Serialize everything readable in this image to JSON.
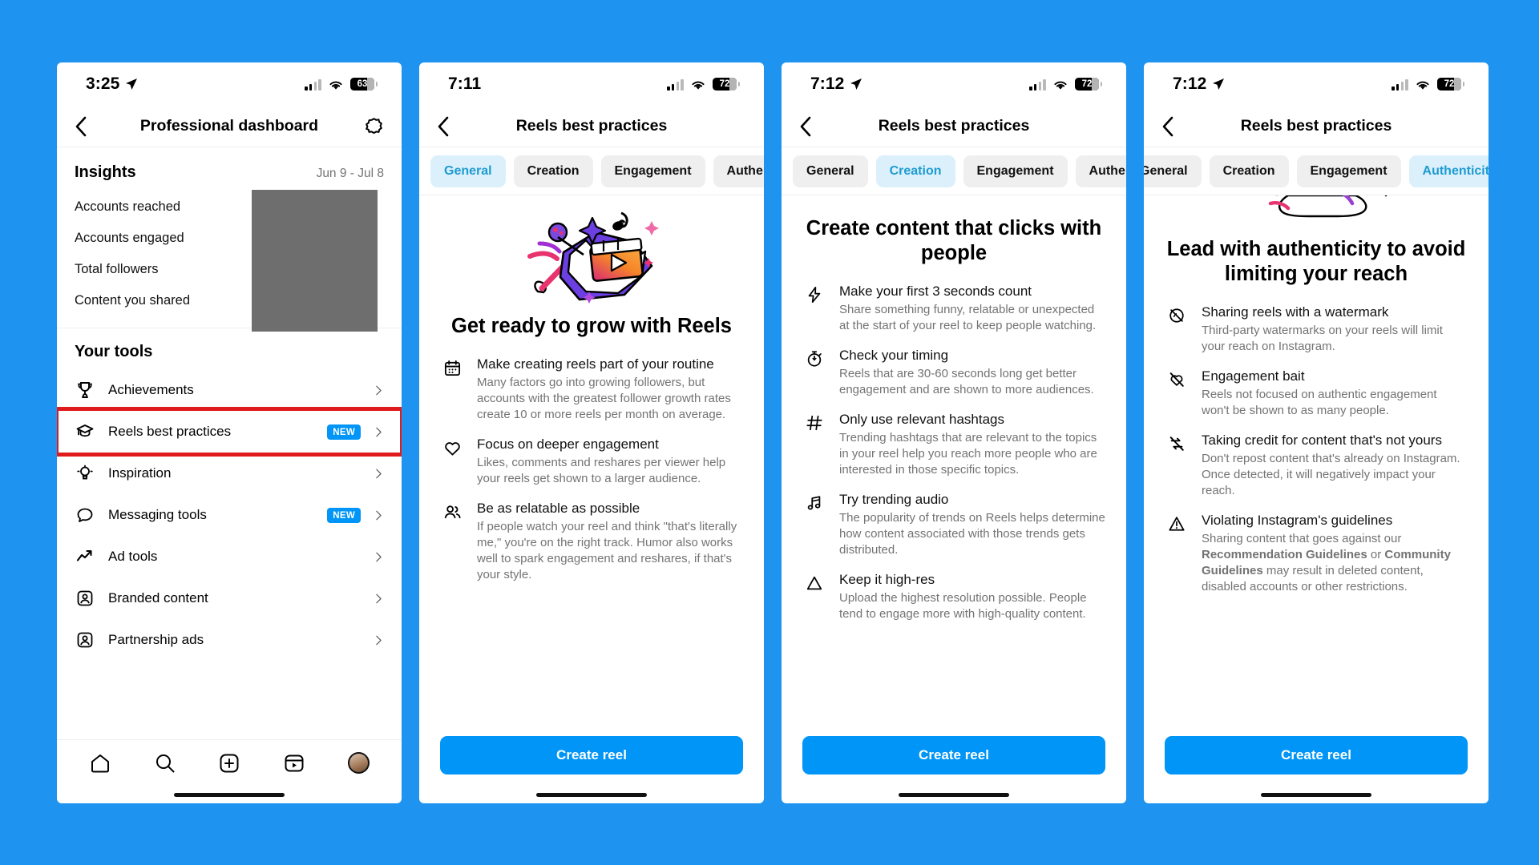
{
  "theme": {
    "background": "#1e94f0",
    "accent": "#0095f6",
    "pill_active_bg": "#dcf0fb",
    "pill_active_text": "#1d9bd1",
    "highlight": "#e01b1b",
    "muted_text": "#737373"
  },
  "panels": [
    {
      "id": "professional-dashboard",
      "status": {
        "time": "3:25",
        "battery": "63",
        "battery_partial": true
      },
      "nav": {
        "title": "Professional dashboard",
        "back_icon": "chevron-left-icon",
        "right_icon": "settings-gear-icon"
      },
      "insights": {
        "title": "Insights",
        "date_range": "Jun 9 - Jul 8",
        "rows": [
          "Accounts reached",
          "Accounts engaged",
          "Total followers",
          "Content you shared"
        ]
      },
      "tools": {
        "title": "Your tools",
        "items": [
          {
            "label": "Achievements",
            "icon": "trophy-icon",
            "badge": ""
          },
          {
            "label": "Reels best practices",
            "icon": "graduation-cap-icon",
            "badge": "NEW",
            "highlighted": true
          },
          {
            "label": "Inspiration",
            "icon": "lightbulb-icon",
            "badge": ""
          },
          {
            "label": "Messaging tools",
            "icon": "chat-bubble-icon",
            "badge": "NEW"
          },
          {
            "label": "Ad tools",
            "icon": "trending-up-icon",
            "badge": ""
          },
          {
            "label": "Branded content",
            "icon": "branded-content-icon",
            "badge": ""
          },
          {
            "label": "Partnership ads",
            "icon": "partnership-ads-icon",
            "badge": ""
          }
        ]
      },
      "tabbar": [
        "home-icon",
        "search-icon",
        "add-post-icon",
        "reels-icon",
        "profile-avatar"
      ]
    },
    {
      "id": "reels-general",
      "status": {
        "time": "7:11",
        "battery": "72",
        "battery_partial": true,
        "show_location": false
      },
      "nav": {
        "title": "Reels best practices",
        "back_icon": "chevron-left-icon"
      },
      "tabs": [
        {
          "label": "General",
          "active": true
        },
        {
          "label": "Creation",
          "active": false
        },
        {
          "label": "Engagement",
          "active": false
        },
        {
          "label": "Authenticity",
          "active": false
        }
      ],
      "hero_icon": "reels-burst-illustration",
      "heading": "Get ready to grow with Reels",
      "tips": [
        {
          "icon": "calendar-icon",
          "title": "Make creating reels part of your routine",
          "desc": "Many factors go into growing followers, but accounts with the greatest follower growth rates create 10 or more reels per month on average."
        },
        {
          "icon": "heart-icon",
          "title": "Focus on deeper engagement",
          "desc": "Likes, comments and reshares per viewer help your reels get shown to a larger audience."
        },
        {
          "icon": "people-icon",
          "title": "Be as relatable as possible",
          "desc": "If people watch your reel and think \"that's literally me,\" you're on the right track. Humor also works well to spark engagement and reshares, if that's your style."
        }
      ],
      "cta": "Create reel"
    },
    {
      "id": "reels-creation",
      "status": {
        "time": "7:12",
        "battery": "72",
        "battery_partial": true
      },
      "nav": {
        "title": "Reels best practices",
        "back_icon": "chevron-left-icon"
      },
      "tabs": [
        {
          "label": "General",
          "active": false
        },
        {
          "label": "Creation",
          "active": true
        },
        {
          "label": "Engagement",
          "active": false
        },
        {
          "label": "Authenticity",
          "active": false
        }
      ],
      "heading": "Create content that clicks with people",
      "tips": [
        {
          "icon": "lightning-bolt-icon",
          "title": "Make your first 3 seconds count",
          "desc": "Share something funny, relatable or unexpected at the start of your reel to keep people watching."
        },
        {
          "icon": "stopwatch-icon",
          "title": "Check your timing",
          "desc": "Reels that are 30-60 seconds long get better engagement and are shown to more audiences."
        },
        {
          "icon": "hashtag-icon",
          "title": "Only use relevant hashtags",
          "desc": "Trending hashtags that are relevant to the topics in your reel help you reach more people who are interested in those specific topics."
        },
        {
          "icon": "music-note-icon",
          "title": "Try trending audio",
          "desc": "The popularity of trends on Reels helps determine how content associated with those trends gets distributed."
        },
        {
          "icon": "triangle-icon",
          "title": "Keep it high-res",
          "desc": "Upload the highest resolution possible. People tend to engage more with high-quality content."
        }
      ],
      "cta": "Create reel"
    },
    {
      "id": "reels-authenticity",
      "status": {
        "time": "7:12",
        "battery": "72",
        "battery_partial": true
      },
      "nav": {
        "title": "Reels best practices",
        "back_icon": "chevron-left-icon"
      },
      "tabs": [
        {
          "label": "General",
          "active": false
        },
        {
          "label": "Creation",
          "active": false
        },
        {
          "label": "Engagement",
          "active": false
        },
        {
          "label": "Authenticity",
          "active": true
        }
      ],
      "hero_icon": "authenticity-illustration",
      "heading": "Lead with authenticity to avoid limiting your reach",
      "tips": [
        {
          "icon": "no-watermark-icon",
          "title": "Sharing reels with a watermark",
          "desc": "Third-party watermarks on your reels will limit your reach on Instagram."
        },
        {
          "icon": "no-engagement-bait-icon",
          "title": "Engagement bait",
          "desc": "Reels not focused on authentic engagement won't be shown to as many people."
        },
        {
          "icon": "no-repost-icon",
          "title": "Taking credit for content that's not yours",
          "desc": "Don't repost content that's already on Instagram. Once detected, it will negatively impact your reach."
        },
        {
          "icon": "warning-triangle-icon",
          "title": "Violating Instagram's guidelines",
          "desc_parts": [
            {
              "text": "Sharing content that goes against our ",
              "link": false
            },
            {
              "text": "Recommendation Guidelines",
              "link": true
            },
            {
              "text": " or ",
              "link": false
            },
            {
              "text": "Community Guidelines",
              "link": true
            },
            {
              "text": " may result in deleted content, disabled accounts or other restrictions.",
              "link": false
            }
          ]
        }
      ],
      "cta": "Create reel"
    }
  ]
}
